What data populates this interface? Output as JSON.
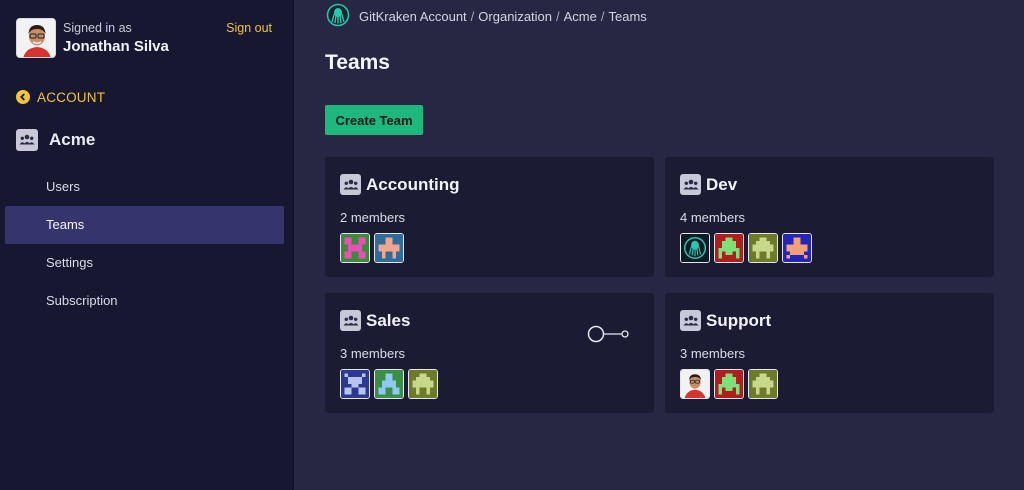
{
  "user": {
    "signed_in_label": "Signed in as",
    "name": "Jonathan Silva",
    "sign_out": "Sign out"
  },
  "sidebar": {
    "back_label": "ACCOUNT",
    "org_name": "Acme",
    "items": [
      {
        "label": "Users",
        "active": false
      },
      {
        "label": "Teams",
        "active": true
      },
      {
        "label": "Settings",
        "active": false
      },
      {
        "label": "Subscription",
        "active": false
      }
    ]
  },
  "breadcrumb": [
    "GitKraken Account",
    "Organization",
    "Acme",
    "Teams"
  ],
  "page_title": "Teams",
  "create_team_label": "Create Team",
  "teams": [
    {
      "name": "Accounting",
      "members_text": "2 members",
      "avatars": [
        "pink-invader",
        "peach-invader"
      ]
    },
    {
      "name": "Dev",
      "members_text": "4 members",
      "avatars": [
        "gitkraken-logo",
        "red-invader",
        "olive-invader",
        "blue-invader"
      ]
    },
    {
      "name": "Sales",
      "members_text": "3 members",
      "avatars": [
        "navy-invader",
        "green-invader",
        "olive-invader"
      ]
    },
    {
      "name": "Support",
      "members_text": "3 members",
      "avatars": [
        "user-photo",
        "red-invader",
        "olive-invader"
      ]
    }
  ],
  "colors": {
    "accent": "#f0c43c",
    "primary_button": "#1eb77e",
    "active_nav": "#35346c",
    "sidebar_bg": "#171731",
    "main_bg": "#272744",
    "card_bg": "#1b1b34"
  }
}
